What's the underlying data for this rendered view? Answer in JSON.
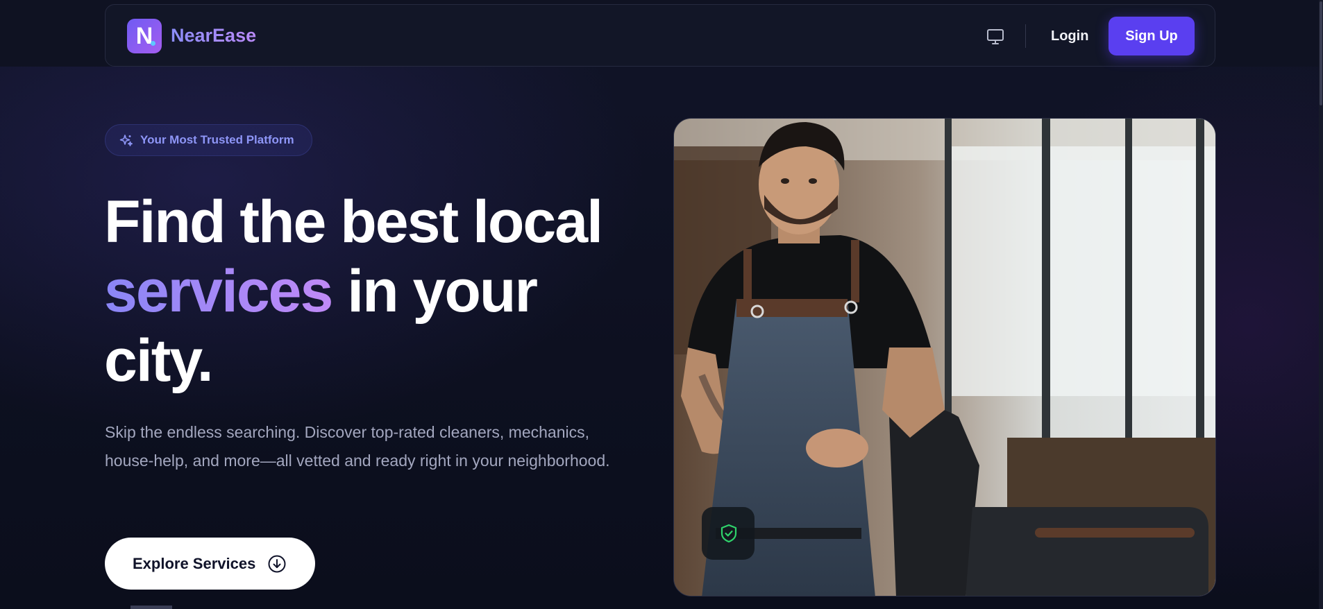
{
  "nav": {
    "brand_letter": "N",
    "brand": "NearEase",
    "login_label": "Login",
    "signup_label": "Sign Up"
  },
  "hero": {
    "badge": "Your Most Trusted Platform",
    "headline_1": "Find the best local",
    "headline_accent": "services",
    "headline_2_rest": " in your",
    "headline_3": "city.",
    "subtext": "Skip the endless searching. Discover top-rated cleaners, mechanics, house-help, and more—all vetted and ready right in your neighborhood.",
    "cta_label": "Explore Services"
  },
  "icons": {
    "theme_toggle": "monitor-icon",
    "badge": "sparkles-icon",
    "cta": "arrow-down-circle-icon",
    "verified": "shield-check-icon"
  },
  "colors": {
    "accent": "#5a3ff0",
    "brand_gradient_start": "#8b8df8",
    "brand_gradient_end": "#b98af8",
    "verified_green": "#2fd36b",
    "background": "#0c0f1f"
  }
}
